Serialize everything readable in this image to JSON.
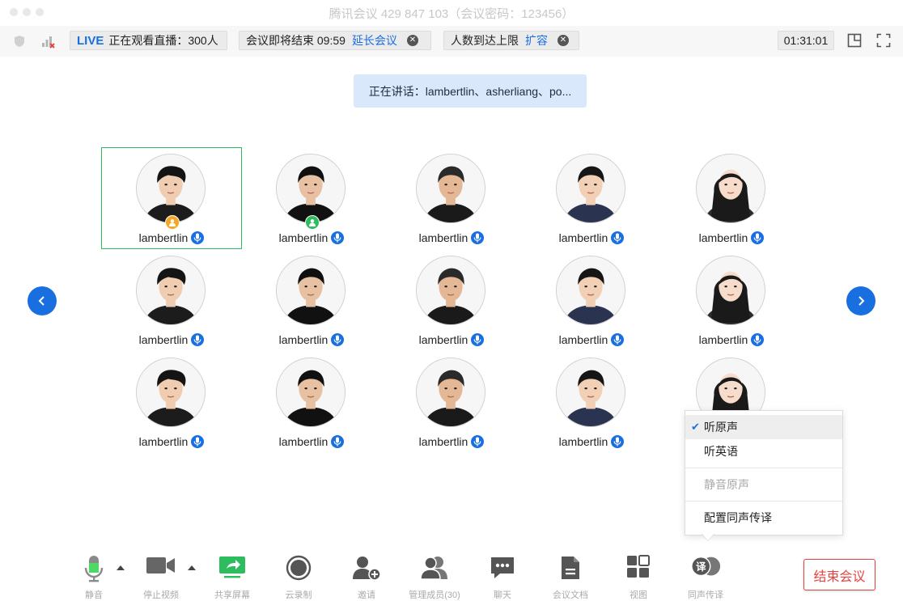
{
  "window": {
    "title": "腾讯会议 429 847 103（会议密码：123456）"
  },
  "infobar": {
    "live_badge": "LIVE",
    "live_text": "正在观看直播：300人",
    "ending_text": "会议即将结束 09:59",
    "extend_link": "延长会议",
    "capacity_text": "人数到达上限",
    "expand_link": "扩容",
    "timer": "01:31:01"
  },
  "speaking": {
    "text": "正在讲话：lambertlin、asherliang、po..."
  },
  "participants": [
    {
      "name": "lambertlin",
      "face": "a",
      "role": "host"
    },
    {
      "name": "lambertlin",
      "face": "b",
      "role": "cohost"
    },
    {
      "name": "lambertlin",
      "face": "c",
      "role": ""
    },
    {
      "name": "lambertlin",
      "face": "d",
      "role": ""
    },
    {
      "name": "lambertlin",
      "face": "e",
      "role": ""
    },
    {
      "name": "lambertlin",
      "face": "a",
      "role": ""
    },
    {
      "name": "lambertlin",
      "face": "b",
      "role": ""
    },
    {
      "name": "lambertlin",
      "face": "c",
      "role": ""
    },
    {
      "name": "lambertlin",
      "face": "d",
      "role": ""
    },
    {
      "name": "lambertlin",
      "face": "e",
      "role": ""
    },
    {
      "name": "lambertlin",
      "face": "a",
      "role": ""
    },
    {
      "name": "lambertlin",
      "face": "b",
      "role": ""
    },
    {
      "name": "lambertlin",
      "face": "c",
      "role": ""
    },
    {
      "name": "lambertlin",
      "face": "d",
      "role": ""
    },
    {
      "name": "lambertlin",
      "face": "e",
      "role": ""
    }
  ],
  "interpretation_menu": {
    "items": [
      "听原声",
      "听英语",
      "静音原声",
      "配置同声传译"
    ],
    "selected": "听原声"
  },
  "toolbar": {
    "labels": [
      "静音",
      "停止视频",
      "共享屏幕",
      "云录制",
      "邀请",
      "管理成员(30)",
      "聊天",
      "会议文档",
      "视图",
      "同声传译"
    ],
    "interpretation_icon_char": "译",
    "end_button": "结束会议"
  },
  "colors": {
    "accent": "#1a6fe0",
    "active_green": "#2dbd5f",
    "end_red": "#e64340",
    "host_orange": "#f5a623"
  }
}
